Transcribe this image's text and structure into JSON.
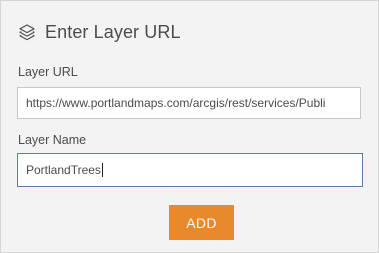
{
  "header": {
    "icon": "layers-icon",
    "title": "Enter Layer URL"
  },
  "fields": {
    "url": {
      "label": "Layer URL",
      "value": "https://www.portlandmaps.com/arcgis/rest/services/Publi"
    },
    "name": {
      "label": "Layer Name",
      "value": "PortlandTrees"
    }
  },
  "actions": {
    "add_label": "ADD"
  },
  "colors": {
    "panel_background": "#f3f3f3",
    "accent_button": "#e8892b",
    "focus_border": "#5a7fa8",
    "text": "#4c4c4c"
  }
}
